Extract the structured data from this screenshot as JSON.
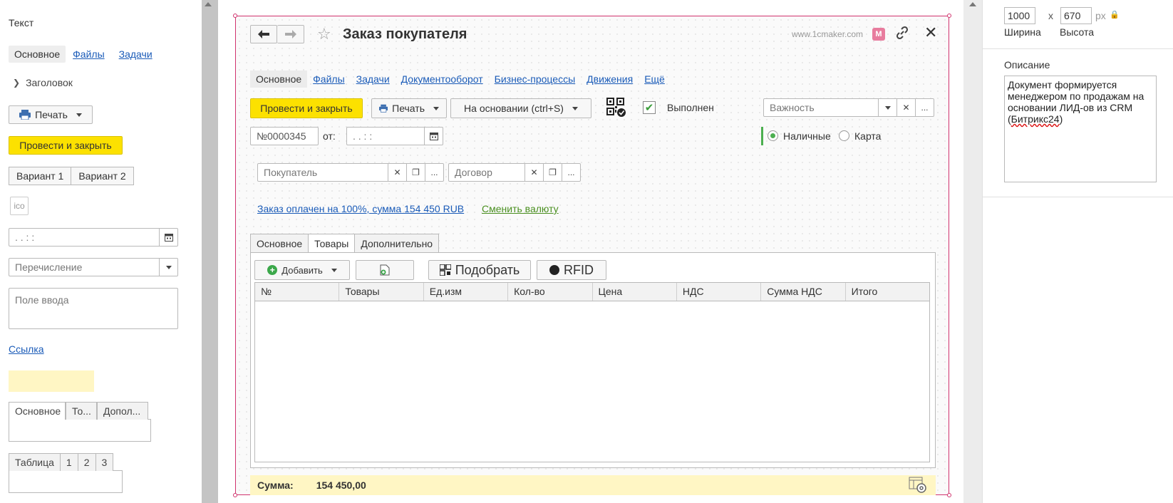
{
  "palette": {
    "text_label": "Текст",
    "tabs": {
      "active": "Основное",
      "files": "Файлы",
      "tasks": "Задачи"
    },
    "header_label": "Заголовок",
    "print_label": "Печать",
    "post_close_label": "Провести и закрыть",
    "variant1": "Вариант 1",
    "variant2": "Вариант 2",
    "ico_label": "ico",
    "date_placeholder": " . . : :",
    "enum_placeholder": "Перечисление",
    "input_placeholder": "Поле ввода",
    "link_label": "Ссылка",
    "tabset": [
      "Основное",
      "То...",
      "Допол..."
    ],
    "table_tabs": [
      "Таблица",
      "1",
      "2",
      "3"
    ]
  },
  "form": {
    "title": "Заказ покупателя",
    "site": "www.1cmaker.com",
    "badge": "M",
    "tabs": {
      "active": "Основное",
      "links": [
        "Файлы",
        "Задачи",
        "Документооборот",
        "Бизнес-процессы",
        "Движения",
        "Ещё"
      ]
    },
    "toolbar": {
      "post_close": "Провести и закрыть",
      "print": "Печать",
      "based_on": "На основании (ctrl+S)",
      "done_label": "Выполнен",
      "importance_placeholder": "Важность"
    },
    "number": "№0000345",
    "from_label": "от:",
    "date_placeholder": " . . : :",
    "payment": {
      "cash": "Наличные",
      "card": "Карта",
      "selected": "cash"
    },
    "buyer_placeholder": "Покупатель",
    "contract_placeholder": "Договор",
    "paid_link": "Заказ оплачен на 100%, сумма 154 450 RUB",
    "currency_link": "Сменить валюту",
    "sub_tabs": [
      "Основное",
      "Товары",
      "Дополнительно"
    ],
    "table_tools": {
      "add": "Добавить",
      "pick": "Подобрать",
      "rfid": "RFID"
    },
    "columns": [
      "№",
      "Товары",
      "Ед.изм",
      "Кол-во",
      "Цена",
      "НДС",
      "Сумма НДС",
      "Итого"
    ],
    "sum_label": "Сумма:",
    "sum_value": "154 450,00"
  },
  "props": {
    "width": "1000",
    "height": "670",
    "x": "x",
    "px": "px",
    "width_label": "Ширина",
    "height_label": "Высота",
    "desc_label": "Описание",
    "desc_main": "Документ формируется менеджером по продажам на основании ЛИД-ов из CRM (",
    "desc_bitrix": "Битрикс24",
    "desc_end": ")"
  },
  "colors": {
    "accent": "#fce100",
    "frame": "#d0326d",
    "link": "#1a5bb8",
    "green": "#4caf50"
  }
}
